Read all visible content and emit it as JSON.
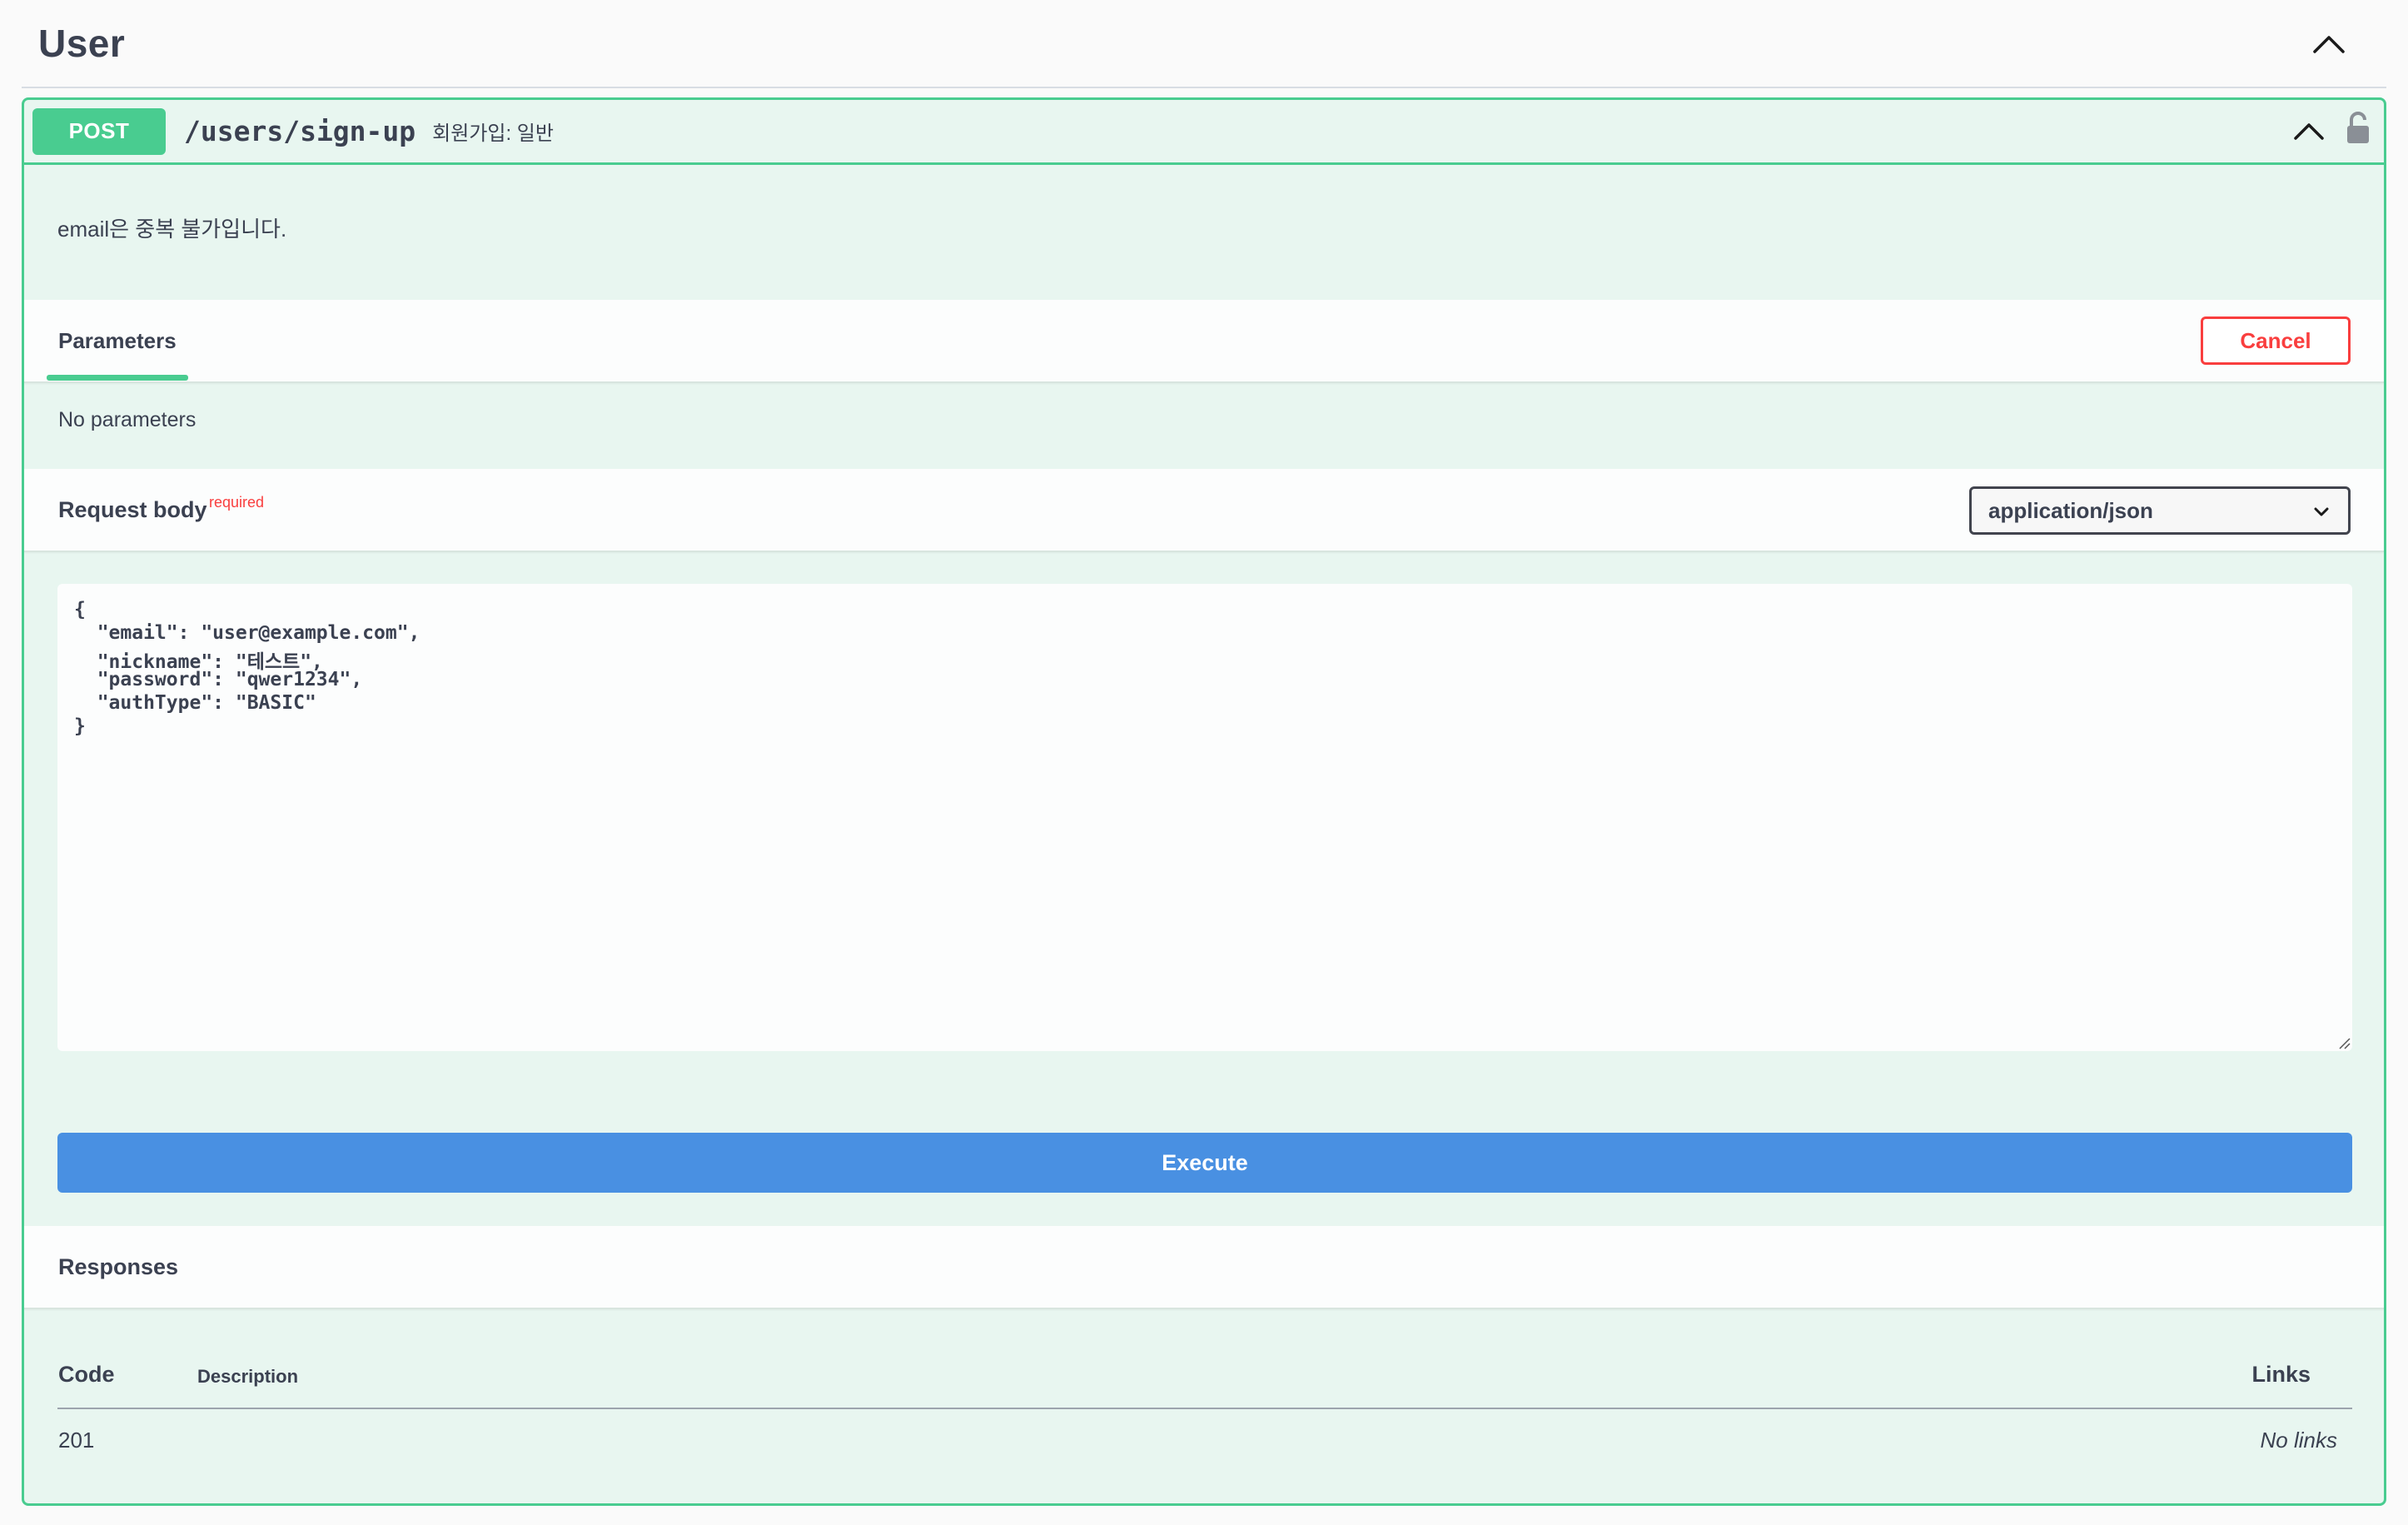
{
  "section": {
    "title": "User"
  },
  "operation": {
    "method": "POST",
    "path": "/users/sign-up",
    "summary": "회원가입: 일반",
    "description": "email은 중복 불가입니다."
  },
  "parameters": {
    "tab_label": "Parameters",
    "cancel_label": "Cancel",
    "empty_text": "No parameters"
  },
  "request_body": {
    "title": "Request body",
    "required_label": "required",
    "content_type": "application/json",
    "lines": [
      "{",
      "  \"email\": \"user@example.com\",",
      "  \"nickname\": \"테스트\",",
      "  \"password\": \"qwer1234\",",
      "  \"authType\": \"BASIC\"",
      "}"
    ]
  },
  "execute_label": "Execute",
  "responses": {
    "title": "Responses",
    "columns": {
      "code": "Code",
      "description": "Description",
      "links": "Links"
    },
    "rows": [
      {
        "code": "201",
        "description": "",
        "links": "No links"
      }
    ]
  },
  "colors": {
    "post_green": "#49cc90",
    "post_bg": "#e8f6f0",
    "cancel_red": "#f93e3e",
    "execute_blue": "#4990e2",
    "text": "#3b4151"
  },
  "icons": {
    "section_toggle": "chevron-up-icon",
    "operation_toggle": "chevron-up-icon",
    "auth": "lock-open-icon",
    "content_type_toggle": "chevron-down-icon",
    "textarea_resize": "resize-handle-icon"
  }
}
